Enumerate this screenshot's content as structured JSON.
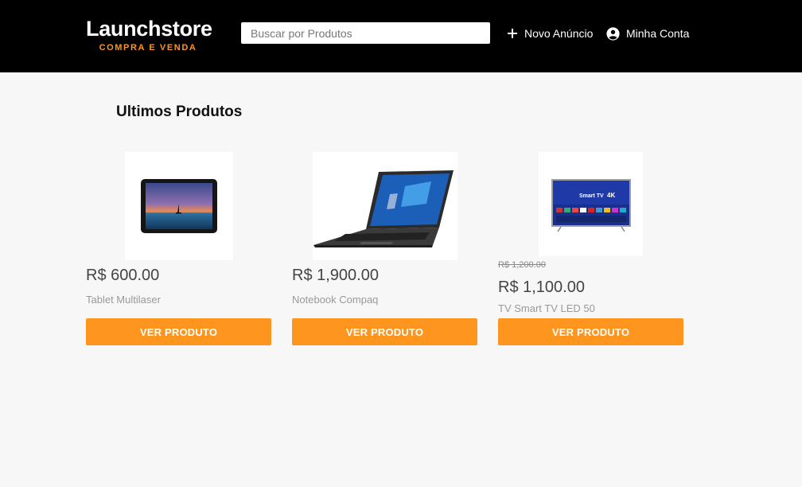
{
  "header": {
    "logo_title": "Launchstore",
    "logo_subtitle": "COMPRA E VENDA",
    "search_placeholder": "Buscar por Produtos",
    "new_ad_label": "Novo Anúncio",
    "account_label": "Minha Conta"
  },
  "main": {
    "section_title": "Ultimos Produtos",
    "products": [
      {
        "name": "Tablet Multilaser",
        "price": "R$ 600.00",
        "old_price": "",
        "image_icon": "tablet-image",
        "button_label": "VER PRODUTO"
      },
      {
        "name": "Notebook Compaq",
        "price": "R$ 1,900.00",
        "old_price": "",
        "image_icon": "laptop-image",
        "button_label": "VER PRODUTO"
      },
      {
        "name": "TV Smart TV LED 50",
        "price": "R$ 1,100.00",
        "old_price": "R$ 1,200.00",
        "image_icon": "smart-tv-image",
        "button_label": "VER PRODUTO"
      }
    ],
    "tv_screen_text": {
      "brand": "Smart TV",
      "resolution": "4K"
    }
  },
  "colors": {
    "header_bg": "#000000",
    "accent": "#fd951f",
    "page_bg": "#f7f7f7"
  }
}
